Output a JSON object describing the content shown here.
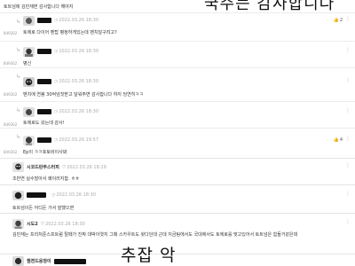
{
  "overlay": {
    "top_right": "국주는 감사합니다",
    "bottom_center": "추잡 악"
  },
  "icons": {
    "clock": "clock-icon",
    "reply_arrow": "reply-arrow-icon",
    "thumb": "thumbs-up-icon",
    "menu": "more-menu-icon"
  },
  "comments": [
    {
      "kind": "text-only",
      "text": "토트넘에 김민재면 감사합니다 해야지"
    },
    {
      "kind": "reply",
      "uid": "849302",
      "date": "2022.03.26 18:30",
      "likes": "2",
      "text": "토에로 다이어 벤탑 평정하게있는데 벤치달구려고?"
    },
    {
      "kind": "reply",
      "uid": "849302",
      "date": "2022.03.26 18:30",
      "text": "병신"
    },
    {
      "kind": "reply",
      "uid": "849302",
      "date": "2022.03.26 18:30",
      "text": "벤치에 연봉 30억넘짓받고 달워주면 감사합니다 하지 딩연히ㅋㅋ"
    },
    {
      "kind": "reply",
      "uid": "849302",
      "date": "2022.03.26 18:30",
      "text": "토에로도 왔는데 감사!"
    },
    {
      "kind": "reply",
      "uid": "849302",
      "date": "2022.03.26 19:57",
      "likes": "4",
      "text": "Ep이 ㅋㅋ호토비이사봐"
    },
    {
      "kind": "top",
      "author": "시코드란무스터피",
      "date": "2022.03.26 18:29",
      "text": "조반연 실수많아서 왜이러지함. ㅎㅎ"
    },
    {
      "kind": "top",
      "author": "",
      "date": "2022.03.26 18:30",
      "text": "토트넘이든 어디든 가서 잘했으면"
    },
    {
      "kind": "top",
      "author": "시도2",
      "date": "2022.03.26 18:30",
      "text": "김민재는 프리처준스프트럼 탈때가 진짜 대박이엿지 그때 스카우트도 왓다던데 근데 지금팀에서도 국대에서도 토에로를 맞고있어서 토트넘은 힘들거같은데"
    },
    {
      "kind": "top",
      "author": "챔젼드응정이",
      "date": "",
      "text": ""
    }
  ]
}
